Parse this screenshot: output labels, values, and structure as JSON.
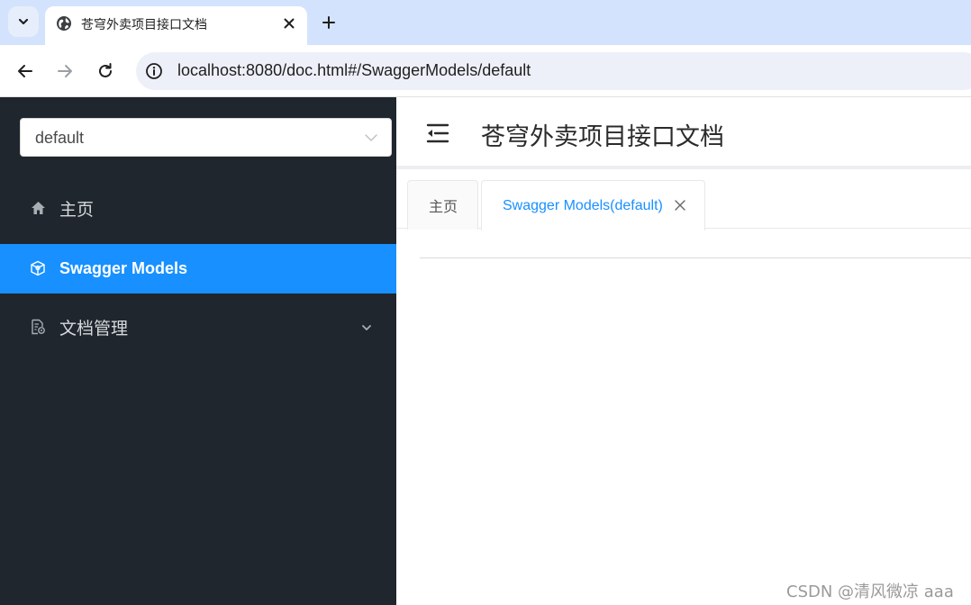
{
  "browser": {
    "tab_title": "苍穹外卖项目接口文档",
    "url": "localhost:8080/doc.html#/SwaggerModels/default"
  },
  "sidebar": {
    "group_select_value": "default",
    "items": [
      {
        "label": "主页",
        "icon": "home-icon"
      },
      {
        "label": "Swagger Models",
        "icon": "cube-icon"
      },
      {
        "label": "文档管理",
        "icon": "doc-settings-icon"
      }
    ]
  },
  "main": {
    "title": "苍穹外卖项目接口文档",
    "tabs": [
      {
        "label": "主页"
      },
      {
        "label": "Swagger Models(default)"
      }
    ]
  },
  "watermark": "CSDN @清风微凉 aaa",
  "colors": {
    "sidebar_bg": "#1f262e",
    "accent": "#1890ff",
    "browser_tabstrip": "#d3e3fd"
  }
}
